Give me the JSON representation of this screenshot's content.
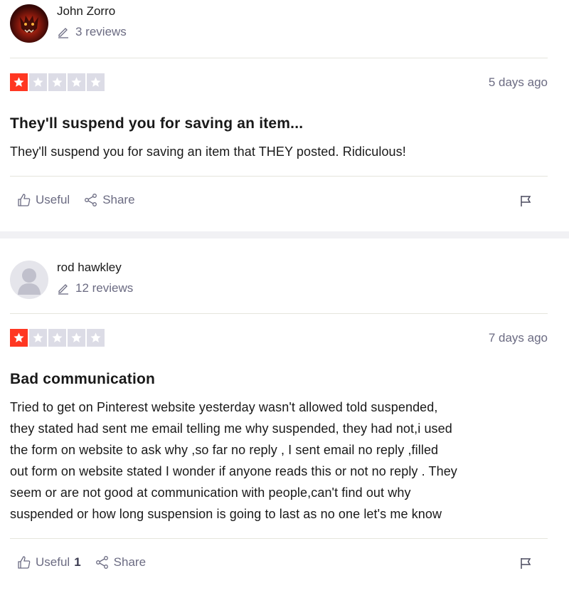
{
  "reviews": [
    {
      "consumer_name": "John Zorro",
      "review_count": "3 reviews",
      "rating": 1,
      "date": "5 days ago",
      "title": "They'll suspend you for saving an item...",
      "body": "They'll suspend you for saving an item that THEY posted. Ridiculous!",
      "useful_label": "Useful",
      "useful_count": "",
      "share_label": "Share"
    },
    {
      "consumer_name": "rod hawkley",
      "review_count": "12 reviews",
      "rating": 1,
      "date": "7 days ago",
      "title": "Bad communication",
      "body_lines": [
        "Tried to get on Pinterest website yesterday wasn't allowed told suspended,",
        "they stated had sent me email telling me why suspended, they had not,i used",
        "the form on website to ask why ,so far no reply , I sent email no reply ,filled",
        "out form on website stated I wonder if anyone reads this or not no reply . They",
        "seem or are not good at communication with people,can't find out why",
        "suspended or how long suspension is going to last as no one let's me know"
      ],
      "useful_label": "Useful",
      "useful_count": "1",
      "share_label": "Share"
    }
  ],
  "icons": {
    "pencil": "pencil-icon",
    "star": "star-icon",
    "thumbs_up": "thumbs-up-icon",
    "share": "share-icon",
    "flag": "flag-icon"
  },
  "colors": {
    "star_filled": "#ff3722",
    "star_empty": "#dcdce6",
    "muted_text": "#6b6b82",
    "separator": "#f1f1f4"
  }
}
